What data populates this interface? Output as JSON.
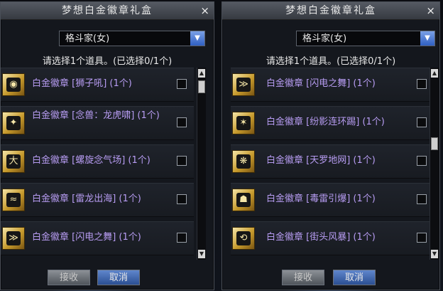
{
  "left": {
    "title": "梦想白金徽章礼盒",
    "close": "×",
    "dropdown": "格斗家(女)",
    "hint": "请选择1个道具。(已选择0/1个)",
    "items": [
      {
        "icon": "lion-roar-icon",
        "glyph": "◉",
        "label": "白金徽章 [狮子吼] (1个)"
      },
      {
        "icon": "tiger-dragon-icon",
        "glyph": "✦",
        "label": "白金徽章 [念兽：龙虎啸] (1个)"
      },
      {
        "icon": "spiral-qi-icon",
        "glyph": "大",
        "label": "白金徽章 [螺旋念气场] (1个)"
      },
      {
        "icon": "thunder-dragon-icon",
        "glyph": "≈",
        "label": "白金徽章 [雷龙出海] (1个)"
      },
      {
        "icon": "lightning-dance-icon",
        "glyph": "≫",
        "label": "白金徽章 [闪电之舞] (1个)"
      }
    ],
    "accept": "接收",
    "cancel": "取消"
  },
  "right": {
    "title": "梦想白金徽章礼盒",
    "close": "×",
    "dropdown": "格斗家(女)",
    "hint": "请选择1个道具。(已选择0/1个)",
    "items": [
      {
        "icon": "lightning-dance-icon",
        "glyph": "≫",
        "label": "白金徽章 [闪电之舞] (1个)"
      },
      {
        "icon": "shadow-kick-icon",
        "glyph": "✶",
        "label": "白金徽章 [纷影连环踢] (1个)"
      },
      {
        "icon": "sky-net-icon",
        "glyph": "❋",
        "label": "白金徽章 [天罗地网] (1个)"
      },
      {
        "icon": "poison-thunder-icon",
        "glyph": "☗",
        "label": "白金徽章 [毒雷引爆] (1个)"
      },
      {
        "icon": "street-storm-icon",
        "glyph": "⟲",
        "label": "白金徽章 [街头风暴] (1个)"
      }
    ],
    "accept": "接收",
    "cancel": "取消"
  }
}
